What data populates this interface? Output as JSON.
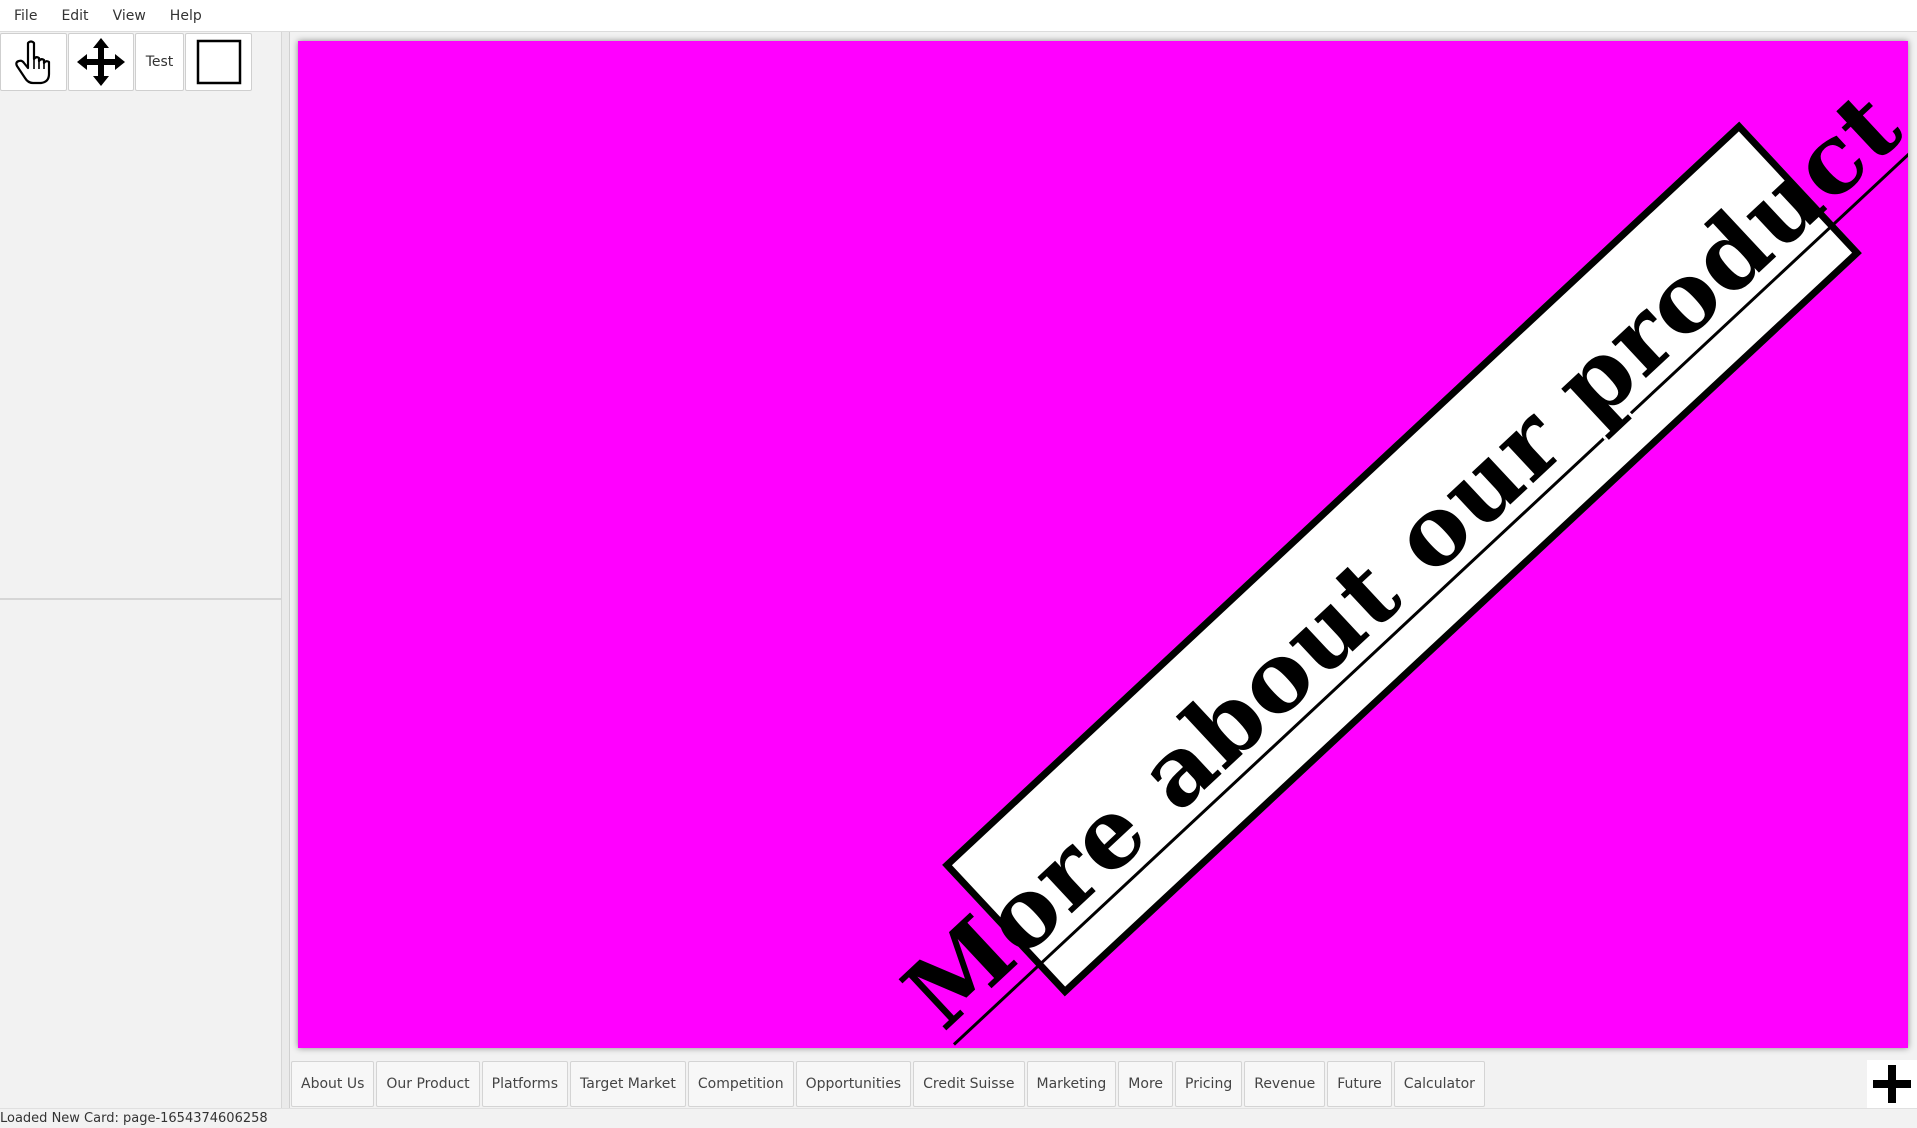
{
  "menubar": {
    "items": [
      "File",
      "Edit",
      "View",
      "Help"
    ]
  },
  "toolbar": {
    "tools": [
      {
        "name": "hand-pointer-icon"
      },
      {
        "name": "move-arrows-icon"
      },
      {
        "label": "Test"
      },
      {
        "name": "rectangle-icon"
      }
    ]
  },
  "card": {
    "background": "#ff00ff",
    "banner_text": "More about our product"
  },
  "tabs": [
    "About Us",
    "Our Product",
    "Platforms",
    "Target Market",
    "Competition",
    "Opportunities",
    "Credit Suisse",
    "Marketing",
    "More",
    "Pricing",
    "Revenue",
    "Future",
    "Calculator"
  ],
  "add_card_icon": "plus-icon",
  "status": {
    "message": "Loaded New Card: page-1654374606258"
  }
}
